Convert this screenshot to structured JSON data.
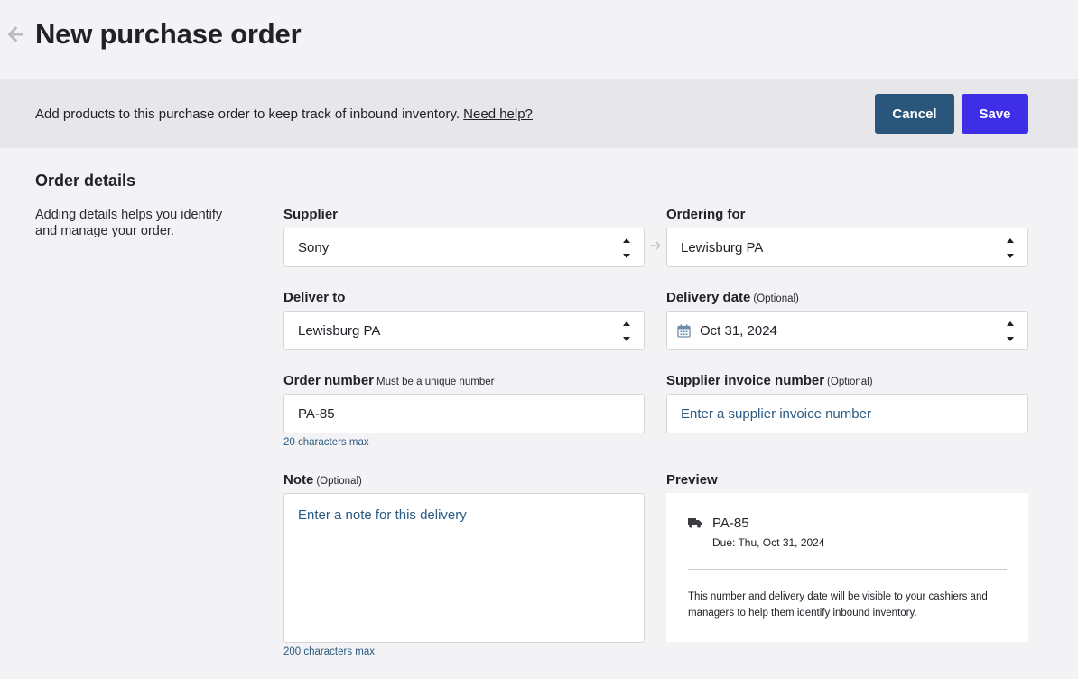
{
  "header": {
    "title": "New purchase order"
  },
  "banner": {
    "text": "Add products to this purchase order to keep track of inbound inventory.",
    "help_link": "Need help?",
    "cancel_label": "Cancel",
    "save_label": "Save"
  },
  "section": {
    "title": "Order details",
    "description": "Adding details helps you identify and manage your order."
  },
  "fields": {
    "supplier": {
      "label": "Supplier",
      "value": "Sony"
    },
    "ordering_for": {
      "label": "Ordering for",
      "value": "Lewisburg PA"
    },
    "deliver_to": {
      "label": "Deliver to",
      "value": "Lewisburg PA"
    },
    "delivery_date": {
      "label": "Delivery date",
      "optional": "(Optional)",
      "value": "Oct 31, 2024"
    },
    "order_number": {
      "label": "Order number",
      "sublabel": "Must be a unique number",
      "value": "PA-85",
      "hint": "20 characters max"
    },
    "supplier_invoice": {
      "label": "Supplier invoice number",
      "optional": "(Optional)",
      "placeholder": "Enter a supplier invoice number"
    },
    "note": {
      "label": "Note",
      "optional": "(Optional)",
      "placeholder": "Enter a note for this delivery",
      "hint": "200 characters max"
    }
  },
  "preview": {
    "label": "Preview",
    "number": "PA-85",
    "due": "Due: Thu, Oct 31, 2024",
    "note": "This number and delivery date will be visible to your cashiers and managers to help them identify inbound inventory."
  },
  "colors": {
    "cancel": "#29567a",
    "save": "#3e2ee8",
    "link": "#2b5a82"
  }
}
